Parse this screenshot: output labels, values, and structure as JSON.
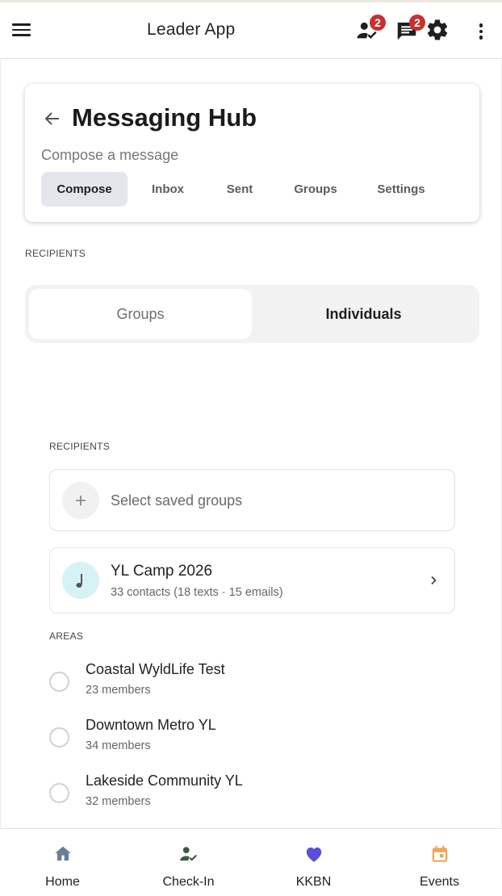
{
  "app_bar": {
    "title": "Leader App",
    "checkin_badge": "2",
    "messages_badge": "2",
    "icons": [
      "menu-icon",
      "person-check-icon",
      "chat-icon",
      "gear-icon",
      "more-vert-icon"
    ]
  },
  "hub": {
    "title": "Messaging Hub",
    "subtitle": "Compose a message",
    "tabs": [
      {
        "label": "Compose",
        "active": true
      },
      {
        "label": "Inbox",
        "active": false
      },
      {
        "label": "Sent",
        "active": false
      },
      {
        "label": "Groups",
        "active": false
      },
      {
        "label": "Settings",
        "active": false
      }
    ]
  },
  "recipients_section": {
    "label": "RECIPIENTS",
    "segments": [
      {
        "label": "Groups",
        "selected": false
      },
      {
        "label": "Individuals",
        "selected": true
      }
    ]
  },
  "recipients_panel": {
    "label": "RECIPIENTS",
    "saved_groups_placeholder": "Select saved groups",
    "selected_group": {
      "name": "YL Camp 2026",
      "details": "33 contacts (18 texts · 15 emails)"
    }
  },
  "areas": {
    "label": "AREAS",
    "items": [
      {
        "name": "Coastal WyldLife Test",
        "members": "23 members",
        "checked": false
      },
      {
        "name": "Downtown Metro YL",
        "members": "34 members",
        "checked": false
      },
      {
        "name": "Lakeside Community YL",
        "members": "32 members",
        "checked": false
      }
    ]
  },
  "bottom_nav": [
    {
      "label": "Home",
      "icon": "home-icon",
      "color": "#6b7f99"
    },
    {
      "label": "Check-In",
      "icon": "person-check-icon",
      "color": "#3f5a40"
    },
    {
      "label": "KKBN",
      "icon": "heart-icon",
      "color": "#5b4fd8"
    },
    {
      "label": "Events",
      "icon": "calendar-icon",
      "color": "#f0a55a"
    }
  ],
  "colors": {
    "badge": "#c9302c",
    "active_tab_bg": "#e4e6ec",
    "camp_icon_bg": "#d6f2f5"
  }
}
